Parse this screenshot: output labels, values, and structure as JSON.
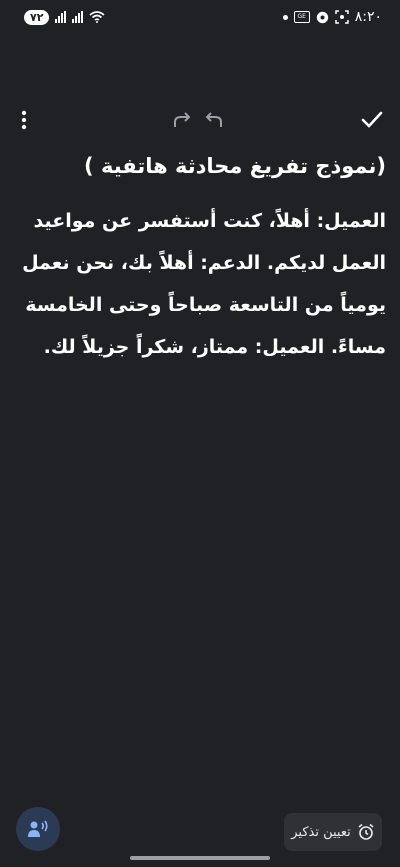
{
  "status_bar": {
    "time": "٨:٢٠",
    "battery": "٧٢",
    "sim_badge": "GE"
  },
  "note": {
    "title": "(نموذج تفريغ محادثة هاتفية )",
    "body": "العميل: أهلاً، كنت أستفسر عن مواعيد العمل لديكم. الدعم: أهلاً بك، نحن نعمل يومياً من التاسعة صباحاً وحتى الخامسة مساءً. العميل: ممتاز، شكراً جزيلاً لك."
  },
  "footer": {
    "reminder_label": "تعيين تذكير"
  },
  "colors": {
    "background": "#202124",
    "fab": "#2b3a55",
    "chip": "#303134",
    "accent_icon": "#8ab4f8"
  },
  "icons": [
    "check-icon",
    "undo-icon",
    "redo-icon",
    "more-vert-icon",
    "voice-icon",
    "alarm-icon",
    "wifi-icon",
    "signal-icon"
  ]
}
